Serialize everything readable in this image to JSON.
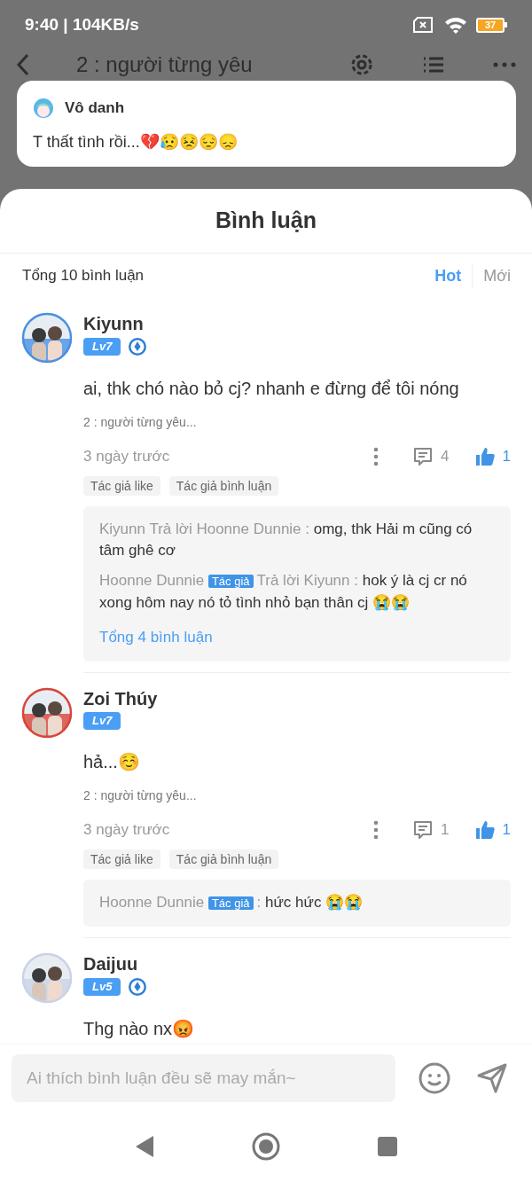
{
  "status_bar": {
    "time": "9:40 | 104KB/s",
    "battery": "37"
  },
  "header": {
    "title": "2 : người từng yêu"
  },
  "notification": {
    "sender": "Vô danh",
    "message": "T thất tình rồi...💔😥😣😔😞"
  },
  "sheet": {
    "title": "Bình luận",
    "total": "Tổng 10 bình luận",
    "sort_tabs": [
      {
        "label": "Hot",
        "selected": true
      },
      {
        "label": "Mới",
        "selected": false
      }
    ]
  },
  "comments": [
    {
      "name": "Kiyunn",
      "level": "Lv7",
      "verified": true,
      "text": "ai, thk chó nào bỏ cj? nhanh e đừng để tôi nóng",
      "chapter": "2 : người từng yêu...",
      "time": "3 ngày trước",
      "reply_count": "4",
      "like_count": "1",
      "liked": true,
      "tags": [
        "Tác giả like",
        "Tác giả bình luận"
      ],
      "replies": [
        {
          "from": "Kiyunn",
          "to": "Trả lời Hoonne Dunnie :",
          "text": "omg, thk Hải m cũng có tâm ghê cơ"
        },
        {
          "from": "Hoonne Dunnie",
          "badge": "Tác giả",
          "to": "Trả lời Kiyunn :",
          "text": "hok ý là cj cr nó xong hôm nay nó tỏ tình nhỏ bạn thân cj 😭😭"
        }
      ],
      "more_link": "Tổng 4 bình luận"
    },
    {
      "name": "Zoi Thúy",
      "level": "Lv7",
      "verified": false,
      "text": "hả...☺️",
      "chapter": "2 : người từng yêu...",
      "time": "3 ngày trước",
      "reply_count": "1",
      "like_count": "1",
      "liked": true,
      "tags": [
        "Tác giả like",
        "Tác giả bình luận"
      ],
      "replies": [
        {
          "from": "Hoonne Dunnie",
          "badge": "Tác giả",
          "to": ":",
          "text": "hức hức 😭😭"
        }
      ]
    },
    {
      "name": "Daijuu",
      "level": "Lv5",
      "verified": true,
      "text": "Thg nào nx😡"
    }
  ],
  "composer": {
    "placeholder": "Ai thích bình luận đều sẽ may mắn~"
  }
}
